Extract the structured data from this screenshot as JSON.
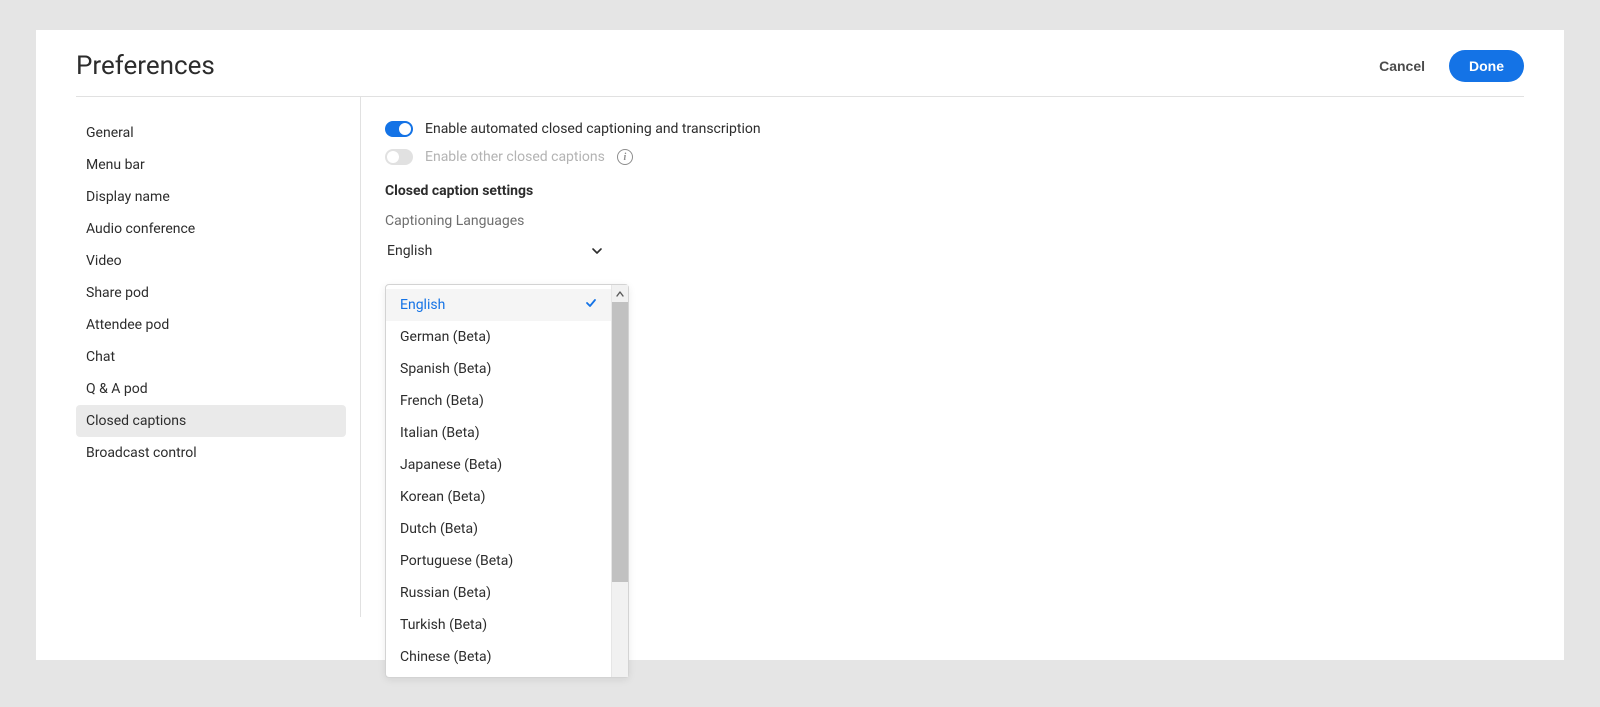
{
  "header": {
    "title": "Preferences",
    "cancel": "Cancel",
    "done": "Done"
  },
  "sidebar": {
    "items": [
      {
        "id": "general",
        "label": "General"
      },
      {
        "id": "menu-bar",
        "label": "Menu bar"
      },
      {
        "id": "display-name",
        "label": "Display name"
      },
      {
        "id": "audio-conference",
        "label": "Audio conference"
      },
      {
        "id": "video",
        "label": "Video"
      },
      {
        "id": "share-pod",
        "label": "Share pod"
      },
      {
        "id": "attendee-pod",
        "label": "Attendee pod"
      },
      {
        "id": "chat",
        "label": "Chat"
      },
      {
        "id": "qa-pod",
        "label": "Q & A pod"
      },
      {
        "id": "closed-captions",
        "label": "Closed captions"
      },
      {
        "id": "broadcast-control",
        "label": "Broadcast control"
      }
    ],
    "active_index": 9
  },
  "main": {
    "toggle_auto_cc": {
      "label": "Enable automated closed captioning and transcription",
      "on": true
    },
    "toggle_other_cc": {
      "label": "Enable other closed captions",
      "on": false,
      "disabled": true
    },
    "section_heading": "Closed caption settings",
    "language_field_label": "Captioning Languages",
    "language_select_value": "English",
    "language_options": [
      {
        "label": "English",
        "selected": true
      },
      {
        "label": "German (Beta)",
        "selected": false
      },
      {
        "label": "Spanish (Beta)",
        "selected": false
      },
      {
        "label": "French (Beta)",
        "selected": false
      },
      {
        "label": "Italian (Beta)",
        "selected": false
      },
      {
        "label": "Japanese (Beta)",
        "selected": false
      },
      {
        "label": "Korean (Beta)",
        "selected": false
      },
      {
        "label": "Dutch (Beta)",
        "selected": false
      },
      {
        "label": "Portuguese (Beta)",
        "selected": false
      },
      {
        "label": "Russian (Beta)",
        "selected": false
      },
      {
        "label": "Turkish (Beta)",
        "selected": false
      },
      {
        "label": "Chinese (Beta)",
        "selected": false
      }
    ]
  }
}
